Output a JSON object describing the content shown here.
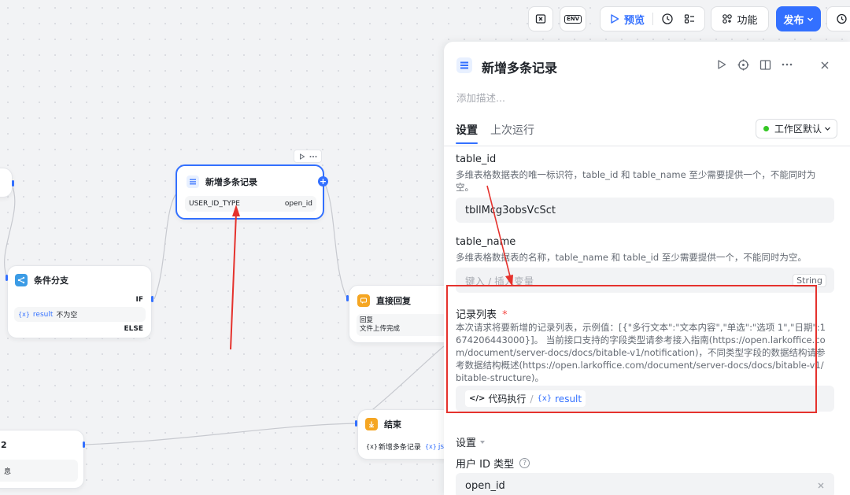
{
  "toolbar": {
    "preview_label": "预览",
    "function_label": "功能",
    "publish_label": "发布",
    "env_label": "ENV"
  },
  "canvas": {
    "node_add_records": {
      "title": "新增多条记录",
      "param_name": "USER_ID_TYPE",
      "param_value": "open_id"
    },
    "node_branch": {
      "title": "条件分支",
      "if_label": "IF",
      "var_tag": "{x}",
      "condition_var": "result",
      "condition_text": "不为空",
      "else_label": "ELSE"
    },
    "node_reply": {
      "title": "直接回复",
      "line1": "回复",
      "line2": "文件上传完成"
    },
    "node_end": {
      "title": "结束",
      "output_tag": "{x}",
      "output_text": "新增多条记录",
      "output_var_tag": "{x}",
      "output_var": "jso"
    },
    "node_bottom_left": {
      "title_fragment": "2",
      "content_fragment": "息"
    }
  },
  "panel": {
    "title": "新增多条记录",
    "description_placeholder": "添加描述...",
    "tab_settings": "设置",
    "tab_last_run": "上次运行",
    "workspace_select": "工作区默认",
    "table_id": {
      "label": "table_id",
      "desc": "多维表格数据表的唯一标识符，table_id 和 table_name 至少需要提供一个，不能同时为空。",
      "value": "tbllMcg3obsVcSct"
    },
    "table_name": {
      "label": "table_name",
      "desc": "多维表格数据表的名称，table_name 和 table_id 至少需要提供一个，不能同时为空。",
      "placeholder": "键入 / 插入变量",
      "type_tag": "String"
    },
    "records": {
      "label": "记录列表",
      "required_mark": "*",
      "desc": "本次请求将要新增的记录列表，示例值：[{\"多行文本\":\"文本内容\",\"单选\":\"选项 1\",\"日期\":1674206443000}]。 当前接口支持的字段类型请参考接入指南(https://open.larkoffice.com/document/server-docs/docs/bitable-v1/notification)，不同类型字段的数据结构请参考数据结构概述(https://open.larkoffice.com/document/server-docs/docs/bitable-v1/bitable-structure)。",
      "source_node": "代码执行",
      "separator": "/",
      "var_tag": "{x}",
      "var_name": "result"
    },
    "settings_section": "设置",
    "user_id_type_label": "用户 ID 类型",
    "user_id_type_value": "open_id"
  },
  "colors": {
    "accent": "#3370ff",
    "annotation_red": "#e5322d",
    "branch_icon": "#3b9be5",
    "reply_icon": "#f5a623",
    "end_icon": "#f5a623",
    "status_green": "#34c724"
  }
}
